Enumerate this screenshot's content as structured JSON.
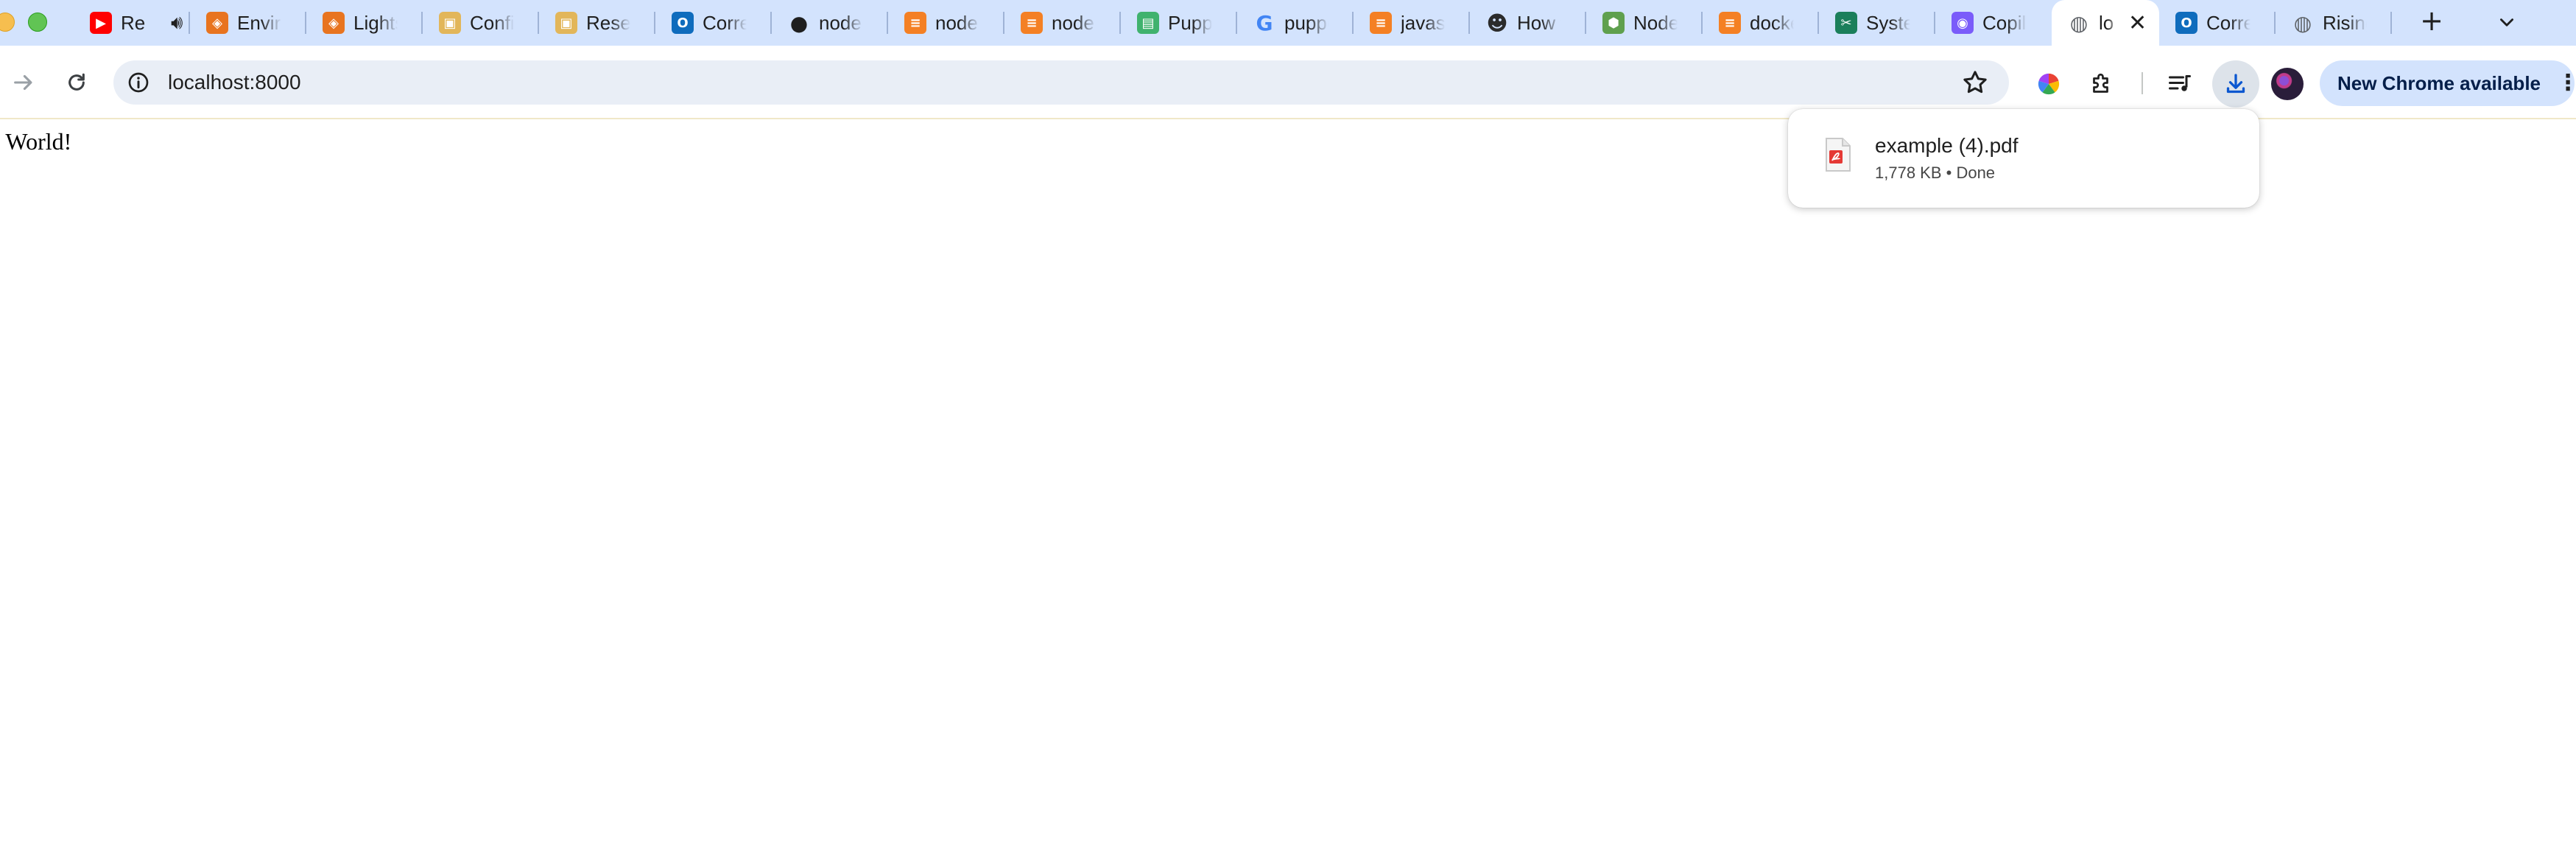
{
  "tabs": [
    {
      "title": "Re",
      "icon": "youtube-icon",
      "color": "#ff0000",
      "glyph": "▶",
      "audio": true
    },
    {
      "title": "Envir",
      "icon": "aws-icon",
      "color": "#e8741f",
      "glyph": "◈"
    },
    {
      "title": "Lights",
      "icon": "aws-icon",
      "color": "#e8741f",
      "glyph": "◈"
    },
    {
      "title": "Confi",
      "icon": "package-icon",
      "color": "#e2b65a",
      "glyph": "▣"
    },
    {
      "title": "Reset",
      "icon": "package-icon",
      "color": "#e2b65a",
      "glyph": "▣"
    },
    {
      "title": "Corre",
      "icon": "outlook-icon",
      "color": "#0f6cbd",
      "glyph": "O"
    },
    {
      "title": "node",
      "icon": "github-icon",
      "color": "#1f1f1f",
      "glyph": "●"
    },
    {
      "title": "node",
      "icon": "stackoverflow-icon",
      "color": "#f48024",
      "glyph": "≡"
    },
    {
      "title": "node",
      "icon": "stackoverflow-icon",
      "color": "#f48024",
      "glyph": "≡"
    },
    {
      "title": "Puppe",
      "icon": "puppeteer-icon",
      "color": "#40b26e",
      "glyph": "▤"
    },
    {
      "title": "puppe",
      "icon": "google-icon",
      "color": "#4285f4",
      "glyph": "G"
    },
    {
      "title": "javas",
      "icon": "stackoverflow-icon",
      "color": "#f48024",
      "glyph": "≡"
    },
    {
      "title": "How t",
      "icon": "ninja-icon",
      "color": "#2b2b2b",
      "glyph": "☻"
    },
    {
      "title": "Node",
      "icon": "nodejs-icon",
      "color": "#5fa04e",
      "glyph": "⬢"
    },
    {
      "title": "docke",
      "icon": "stackoverflow-icon",
      "color": "#f48024",
      "glyph": "≡"
    },
    {
      "title": "Syste",
      "icon": "tools-icon",
      "color": "#1b7f5b",
      "glyph": "✂"
    },
    {
      "title": "Copil",
      "icon": "copilot-icon",
      "color": "#7a5cfa",
      "glyph": "◉"
    },
    {
      "title": "lo",
      "icon": "globe-icon",
      "color": "#5f6368",
      "glyph": "◍",
      "active": true
    },
    {
      "title": "Corre",
      "icon": "outlook-icon",
      "color": "#0f6cbd",
      "glyph": "O"
    },
    {
      "title": "Rising",
      "icon": "globe-icon",
      "color": "#5f6368",
      "glyph": "◍"
    }
  ],
  "toolbar": {
    "url": "localhost:8000",
    "update_label": "New Chrome available"
  },
  "page": {
    "text": "o World!"
  },
  "download": {
    "filename": "example (4).pdf",
    "meta": "1,778 KB • Done"
  }
}
